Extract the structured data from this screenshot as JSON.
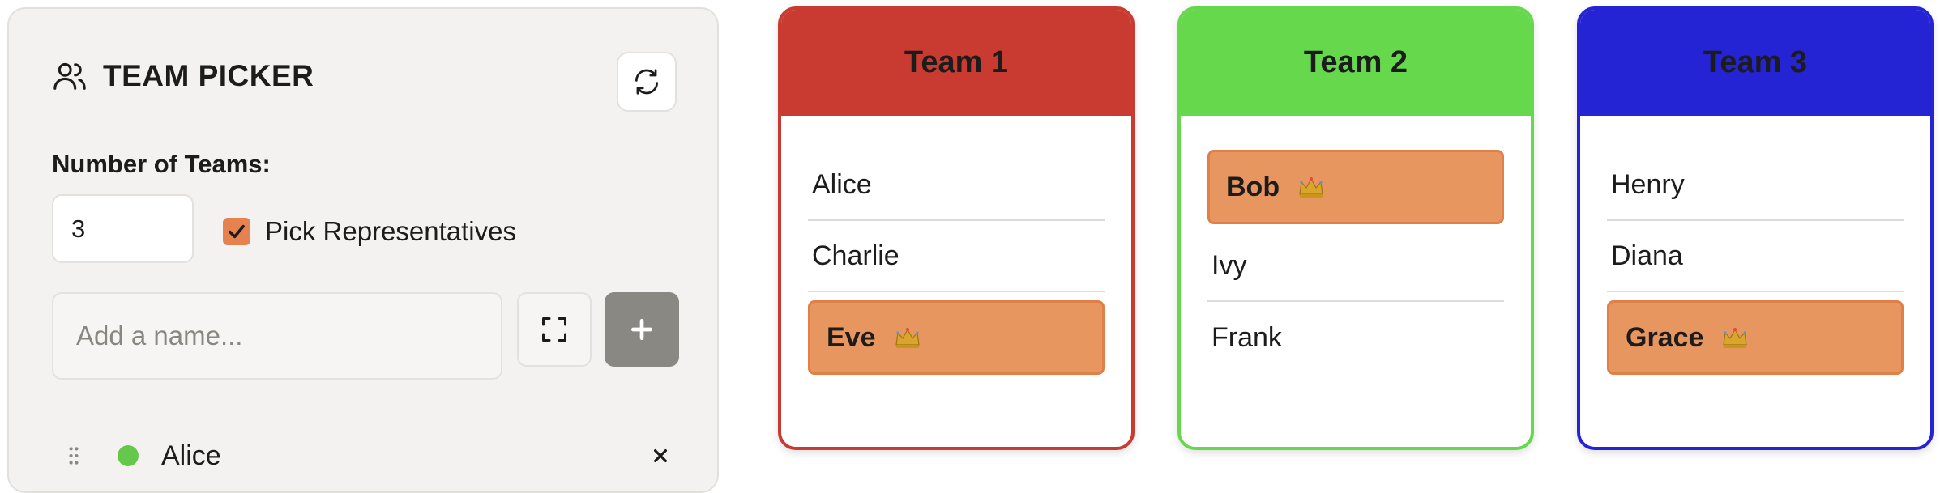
{
  "panel": {
    "title": "TEAM PICKER",
    "icons": {
      "header": "users-icon",
      "refresh": "refresh-icon",
      "scan": "scan-frame-icon",
      "add": "plus-icon",
      "drag": "drag-handle-icon",
      "remove": "close-icon"
    },
    "teams_label": "Number of Teams:",
    "teams_value": "3",
    "representatives_label": "Pick Representatives",
    "representatives_checked": true,
    "name_placeholder": "Add a name...",
    "players": [
      {
        "name": "Alice",
        "status_color": "#66c84a"
      }
    ]
  },
  "teams": [
    {
      "title": "Team 1",
      "color": "#c93b31",
      "members": [
        {
          "name": "Alice",
          "representative": false
        },
        {
          "name": "Charlie",
          "representative": false
        },
        {
          "name": "Eve",
          "representative": true
        }
      ]
    },
    {
      "title": "Team 2",
      "color": "#66d84c",
      "members": [
        {
          "name": "Bob",
          "representative": true
        },
        {
          "name": "Ivy",
          "representative": false
        },
        {
          "name": "Frank",
          "representative": false
        }
      ]
    },
    {
      "title": "Team 3",
      "color": "#2424d4",
      "members": [
        {
          "name": "Henry",
          "representative": false
        },
        {
          "name": "Diana",
          "representative": false
        },
        {
          "name": "Grace",
          "representative": true
        }
      ]
    }
  ],
  "colors": {
    "accent": "#e5824f",
    "representative_bg": "#e8965f",
    "add_button": "#8a8882"
  }
}
